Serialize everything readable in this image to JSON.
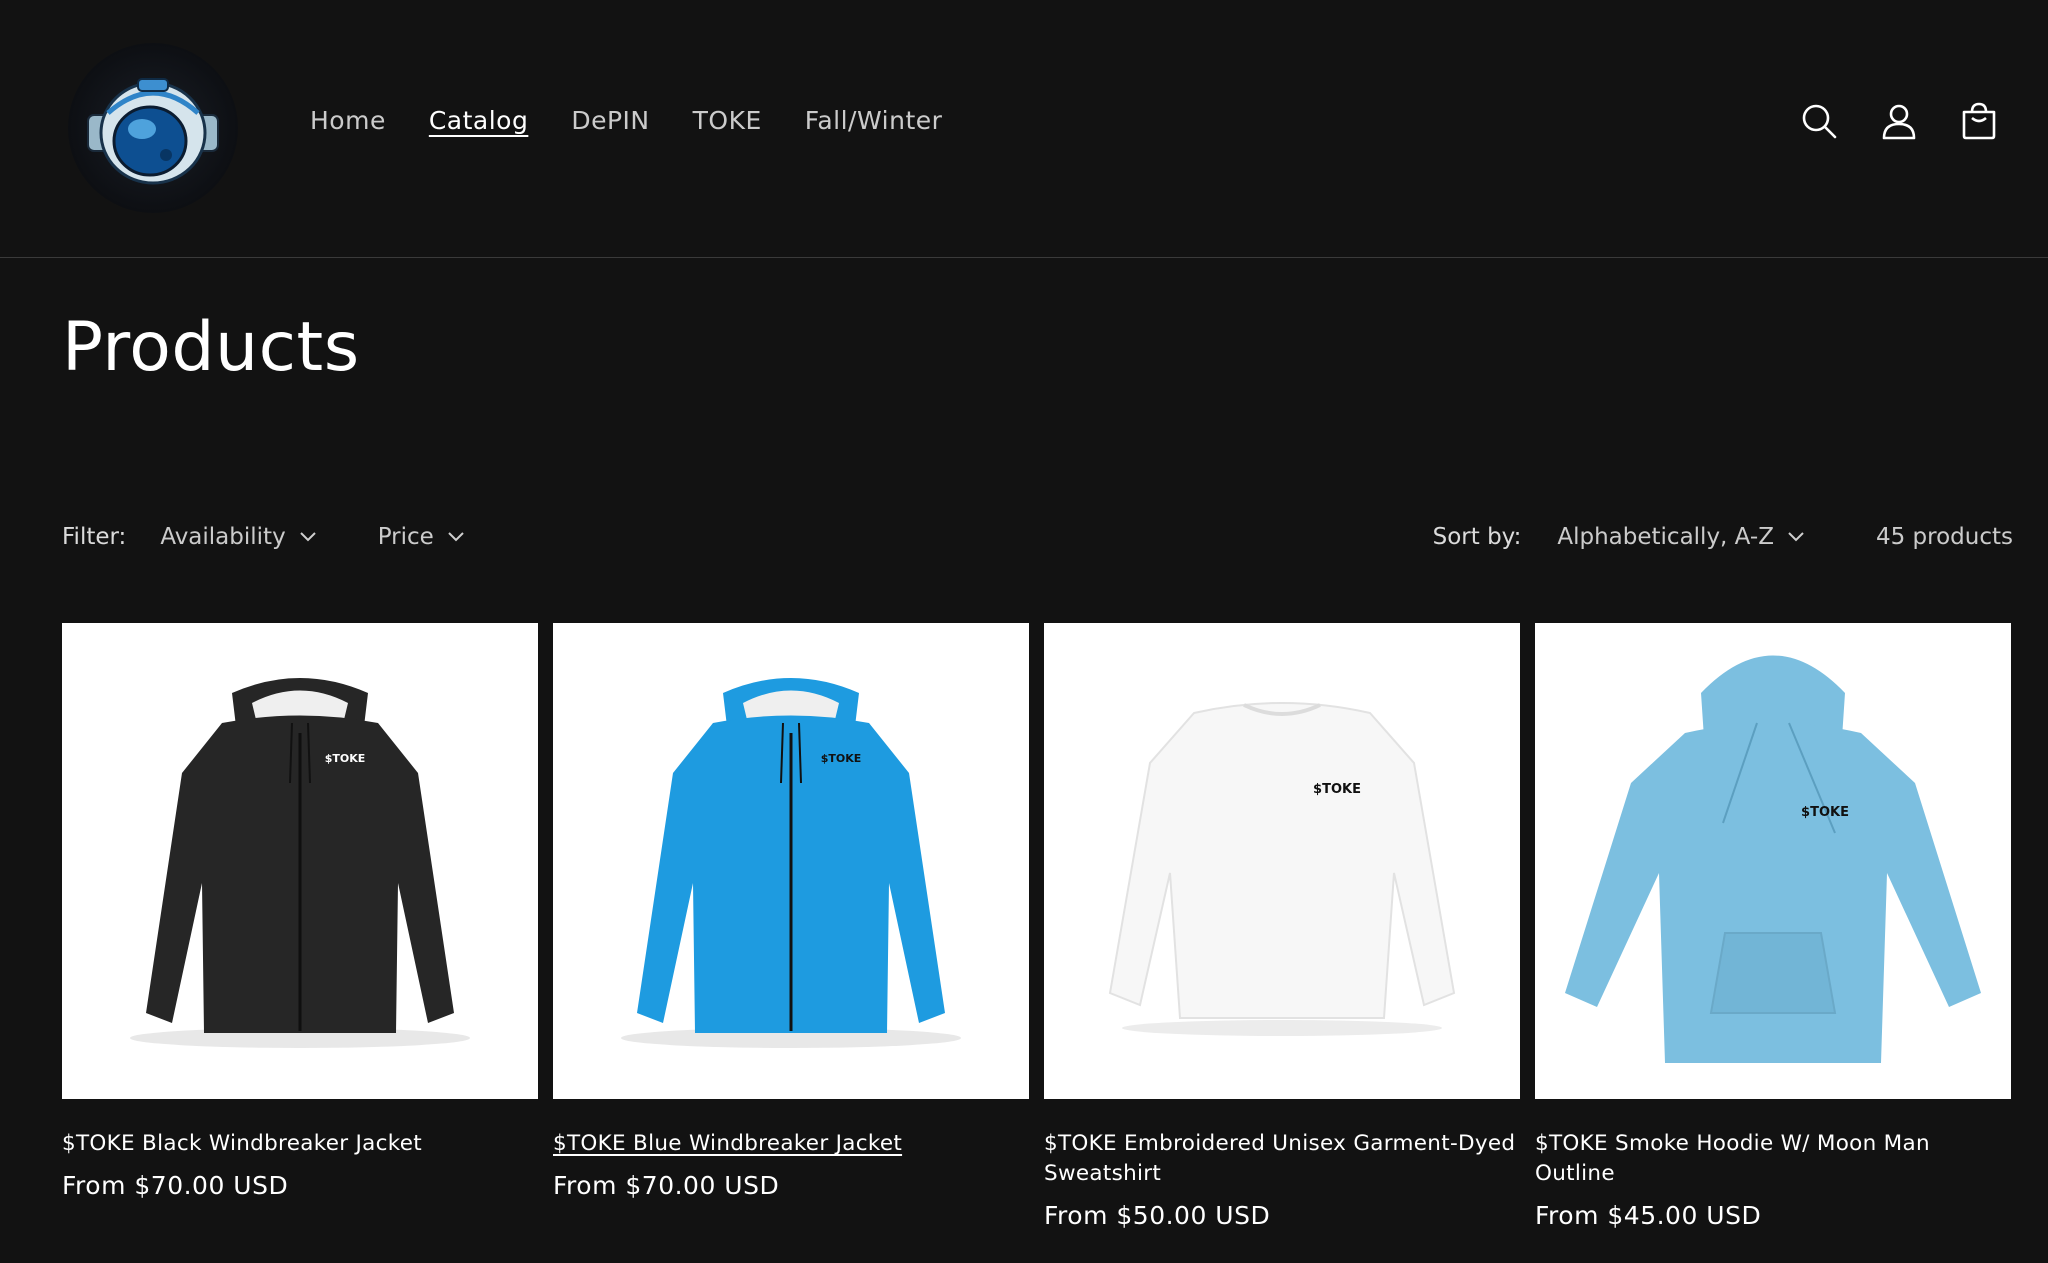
{
  "header": {
    "nav": [
      {
        "label": "Home"
      },
      {
        "label": "Catalog"
      },
      {
        "label": "DePIN"
      },
      {
        "label": "TOKE"
      },
      {
        "label": "Fall/Winter"
      }
    ],
    "icons": [
      "search-icon",
      "account-icon",
      "cart-icon"
    ]
  },
  "page": {
    "title": "Products"
  },
  "filters": {
    "label": "Filter:",
    "availability": "Availability",
    "price": "Price"
  },
  "sort": {
    "label": "Sort by:",
    "value": "Alphabetically, A-Z",
    "count": "45 products"
  },
  "products": [
    {
      "title": "$TOKE Black Windbreaker Jacket",
      "price": "From $70.00 USD",
      "color": "#1f1f1f"
    },
    {
      "title": "$TOKE Blue Windbreaker Jacket",
      "price": "From $70.00 USD",
      "color": "#1e9be0"
    },
    {
      "title": "$TOKE Embroidered Unisex Garment-Dyed Sweatshirt",
      "price": "From $50.00 USD",
      "color": "#f7f7f7"
    },
    {
      "title": "$TOKE Smoke Hoodie W/ Moon Man Outline",
      "price": "From $45.00 USD",
      "color": "#7cbfe0"
    }
  ],
  "brand_text_on_garments": "$TOKE"
}
